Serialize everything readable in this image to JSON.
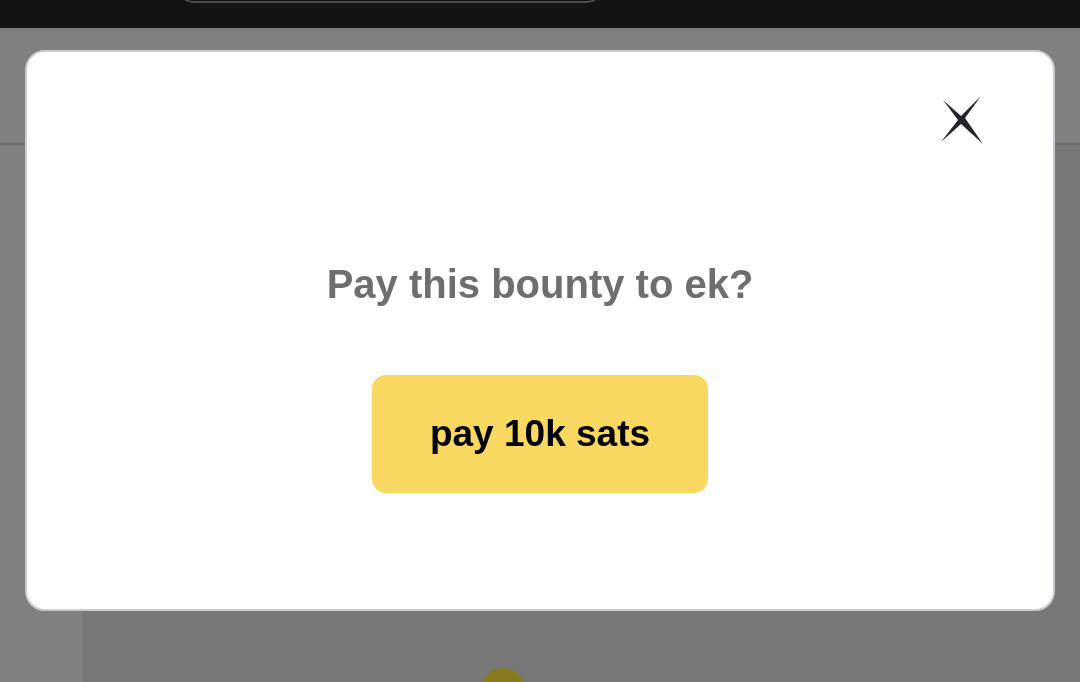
{
  "dialog": {
    "title": "Pay this bounty to ek?",
    "button": "pay 10k sats"
  }
}
